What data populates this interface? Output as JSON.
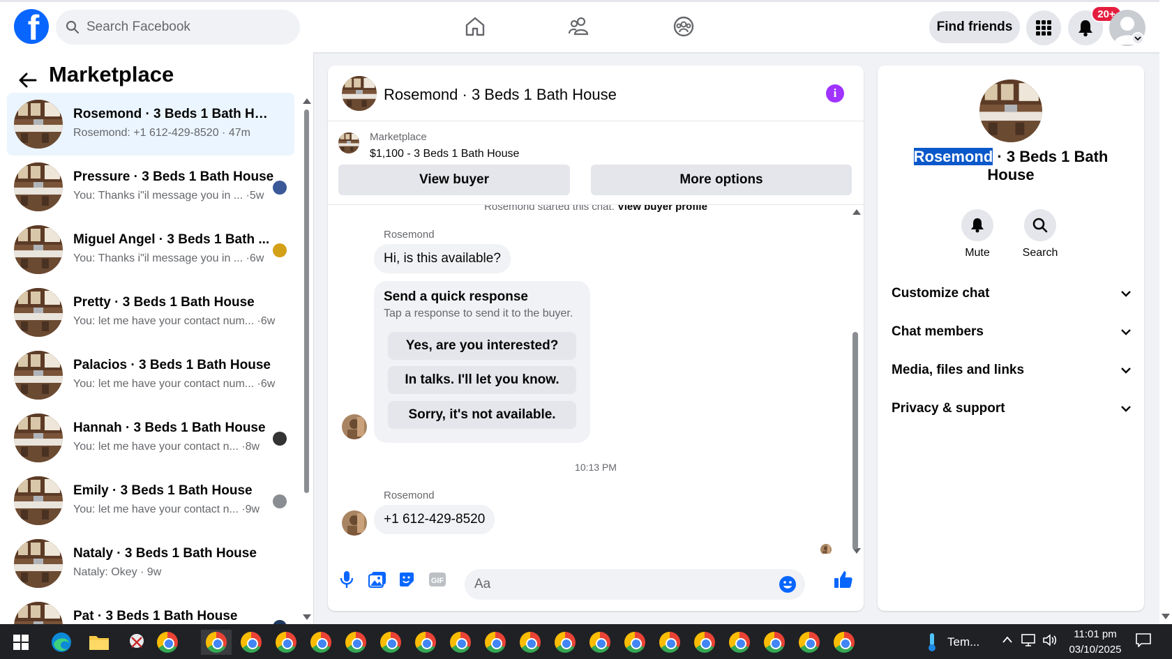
{
  "colors": {
    "brand": "#0866ff",
    "accent_purple": "#a033ff",
    "badge_red": "#e41e3f",
    "selection": "#0a58ca"
  },
  "topbar": {
    "search_placeholder": "Search Facebook",
    "find_friends_label": "Find friends",
    "notification_count": "20+",
    "icons": [
      "home-icon",
      "friends-icon",
      "groups-icon",
      "apps-grid-icon",
      "bell-icon"
    ]
  },
  "left_panel": {
    "title": "Marketplace",
    "chats": [
      {
        "name": "Rosemond · 3 Beds 1 Bath House",
        "preview": "Rosemond: +1 612-429-8520 · 47m",
        "active": true
      },
      {
        "name": "Pressure · 3 Beds 1 Bath House",
        "preview": "You: Thanks i\"il message you in ... ·5w"
      },
      {
        "name": "Miguel Angel · 3 Beds 1 Bath ...",
        "preview": "You: Thanks i\"il message you in ... ·6w"
      },
      {
        "name": "Pretty · 3 Beds 1 Bath House",
        "preview": "You: let me have your contact num... ·6w"
      },
      {
        "name": "Palacios · 3 Beds 1 Bath House",
        "preview": "You: let me have your contact num... ·6w"
      },
      {
        "name": "Hannah · 3 Beds 1 Bath House",
        "preview": "You: let me have your contact n... ·8w"
      },
      {
        "name": "Emily · 3 Beds 1 Bath House",
        "preview": "You: let me have your contact n... ·9w"
      },
      {
        "name": "Nataly · 3 Beds 1 Bath House",
        "preview": "Nataly: Okey · 9w"
      },
      {
        "name": "Pat · 3 Beds 1 Bath House",
        "preview": ""
      }
    ]
  },
  "conversation": {
    "title": "Rosemond · 3 Beds 1 Bath House",
    "listing_source": "Marketplace",
    "listing_price": "$1,100 - 3 Beds 1 Bath House",
    "view_buyer_label": "View buyer",
    "more_options_label": "More options",
    "chat_started_text": "Rosemond started this chat.",
    "chat_started_link": "View buyer profile",
    "sender_1": "Rosemond",
    "message_1": "Hi, is this available?",
    "quick_title": "Send a quick response",
    "quick_subtitle": "Tap a response to send it to the buyer.",
    "quick_options": [
      "Yes, are you interested?",
      "In talks. I'll let you know.",
      "Sorry, it's not available."
    ],
    "timestamp": "10:13 PM",
    "sender_2": "Rosemond",
    "message_2": "+1 612-429-8520",
    "composer_placeholder": "Aa"
  },
  "right_panel": {
    "title_highlight": "Rosemond",
    "title_rest": " · 3 Beds 1 Bath House",
    "mute_label": "Mute",
    "search_label": "Search",
    "sections": [
      "Customize chat",
      "Chat members",
      "Media, files and links",
      "Privacy & support"
    ]
  },
  "taskbar": {
    "weather_text": "Tem...",
    "clock_time": "11:01 pm",
    "clock_date": "03/10/2025"
  }
}
